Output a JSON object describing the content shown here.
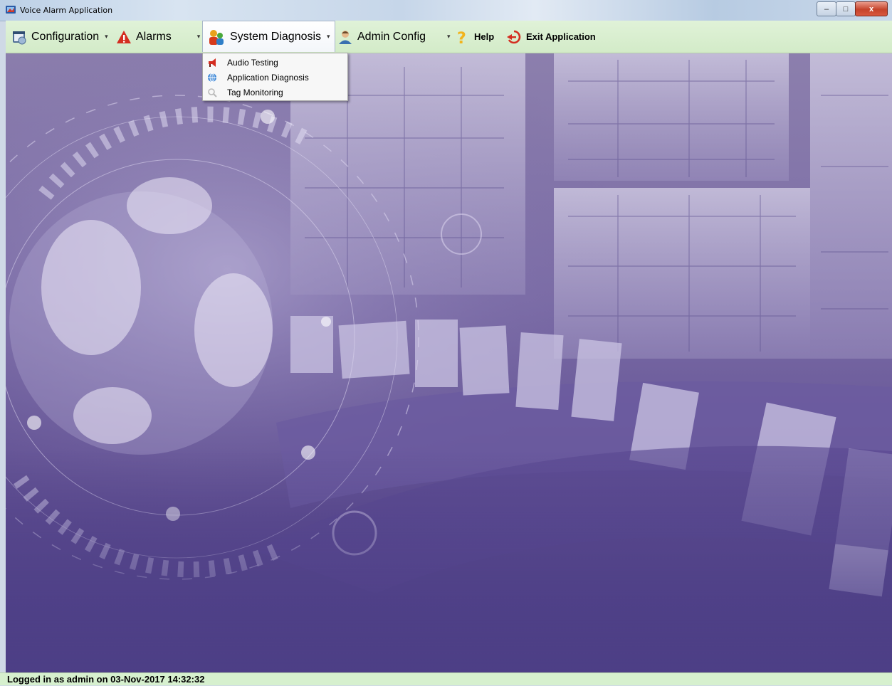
{
  "window": {
    "title": "Voice Alarm Application",
    "controls": {
      "minimize": "–",
      "maximize": "□",
      "close": "x"
    }
  },
  "menubar": {
    "items": [
      {
        "label": "Configuration",
        "icon": "calendar-icon",
        "has_dropdown": true
      },
      {
        "label": "Alarms",
        "icon": "warning-icon",
        "has_dropdown": true
      },
      {
        "label": "System Diagnosis",
        "icon": "diagnosis-icon",
        "has_dropdown": true,
        "active": true
      },
      {
        "label": "Admin Config",
        "icon": "admin-user-icon",
        "has_dropdown": true
      },
      {
        "label": "Help",
        "icon": "help-icon"
      },
      {
        "label": "Exit Application",
        "icon": "exit-icon"
      }
    ],
    "dropdown_arrow": "▾"
  },
  "dropdown": {
    "items": [
      {
        "label": "Audio Testing",
        "icon": "megaphone-icon"
      },
      {
        "label": "Application Diagnosis",
        "icon": "globe-icon"
      },
      {
        "label": "Tag Monitoring",
        "icon": "magnifier-icon"
      }
    ]
  },
  "statusbar": {
    "text": "Logged in as admin on 03-Nov-2017 14:32:32"
  },
  "colors": {
    "menubar_bg": "#d6edcb",
    "statusbar_bg": "#d6f0ce",
    "background_purple": "#5c4b8f"
  }
}
